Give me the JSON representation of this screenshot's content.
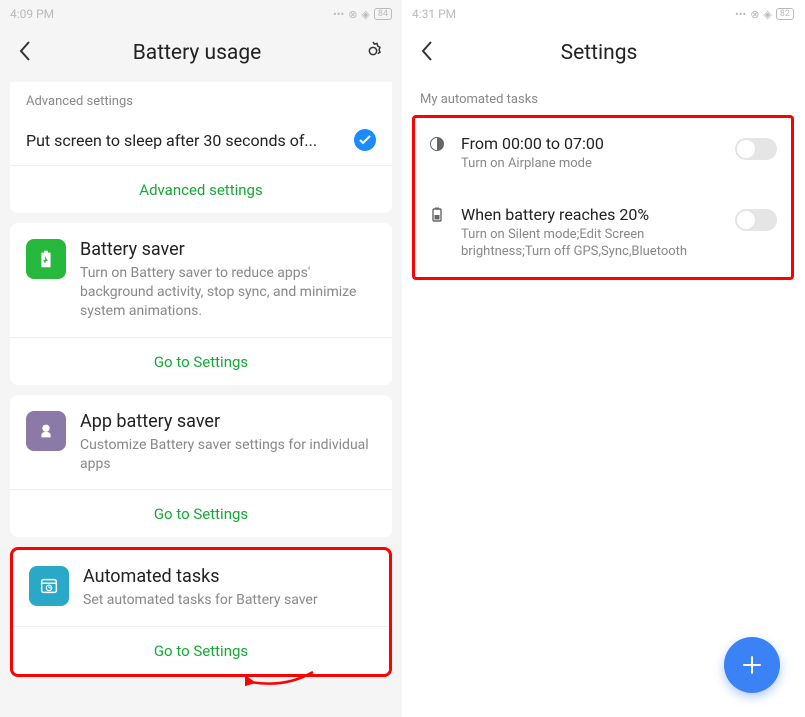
{
  "left": {
    "status_time": "4:09 PM",
    "status_batt": "84",
    "title": "Battery  usage",
    "advanced_section": "Advanced settings",
    "sleep_row": "Put screen to sleep after 30 seconds of...",
    "advanced_link": "Advanced settings",
    "cards": {
      "battery_saver": {
        "title": "Battery saver",
        "desc": "Turn on Battery saver to reduce apps' background activity, stop sync, and minimize system animations.",
        "link": "Go to Settings",
        "icon_bg": "#26b93d"
      },
      "app_battery_saver": {
        "title": "App battery saver",
        "desc": "Customize Battery saver settings for individual apps",
        "link": "Go to Settings",
        "icon_bg": "#8b7aa8"
      },
      "automated_tasks": {
        "title": "Automated tasks",
        "desc": "Set automated tasks for Battery saver",
        "link": "Go to Settings",
        "icon_bg": "#2aa8c7"
      }
    }
  },
  "right": {
    "status_time": "4:31 PM",
    "status_batt": "82",
    "title": "Settings",
    "section": "My automated tasks",
    "tasks": [
      {
        "title": "From 00:00 to 07:00",
        "desc": "Turn on Airplane mode",
        "icon": "moon"
      },
      {
        "title": "When battery reaches 20%",
        "desc": "Turn on Silent mode;Edit Screen brightness;Turn off GPS,Sync,Bluetooth",
        "icon": "battery"
      }
    ]
  }
}
